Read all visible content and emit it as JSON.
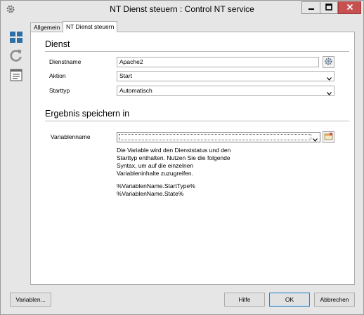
{
  "window": {
    "title": "NT Dienst steuern : Control NT service"
  },
  "titlebar_icons": {
    "app": "gear-icon",
    "minimize": "minimize-icon",
    "maximize": "maximize-icon",
    "close": "close-icon"
  },
  "sidebar": {
    "icons": [
      "grid-view-icon",
      "refresh-icon",
      "properties-icon"
    ]
  },
  "tabs": [
    {
      "label": "Allgemein",
      "active": false
    },
    {
      "label": "NT Dienst steuern",
      "active": true
    }
  ],
  "dienst": {
    "section_title": "Dienst",
    "dienstname_label": "Dienstname",
    "dienstname_value": "Apache2",
    "aktion_label": "Aktion",
    "aktion_value": "Start",
    "starttyp_label": "Starttyp",
    "starttyp_value": "Automatisch"
  },
  "ergebnis": {
    "section_title": "Ergebnis speichern in",
    "variablenname_label": "Variablenname",
    "variablenname_value": "",
    "hint_text": "Die Variable wird den Dienststatus und den\nStarttyp enthalten. Nutzen Sie die folgende\nSyntax, um auf die einzelnen\nVariableninhalte zuzugreifen.",
    "syntax_line1": "%VariablenName.StartType%",
    "syntax_line2": "%VariablenName.State%"
  },
  "buttons": {
    "variablen": "Variablen...",
    "hilfe": "Hilfe",
    "ok": "OK",
    "abbrechen": "Abbrechen"
  },
  "colors": {
    "close_button": "#c75050",
    "accent": "#3c7fb1",
    "sidebar_icon": "#2e6fa8"
  }
}
